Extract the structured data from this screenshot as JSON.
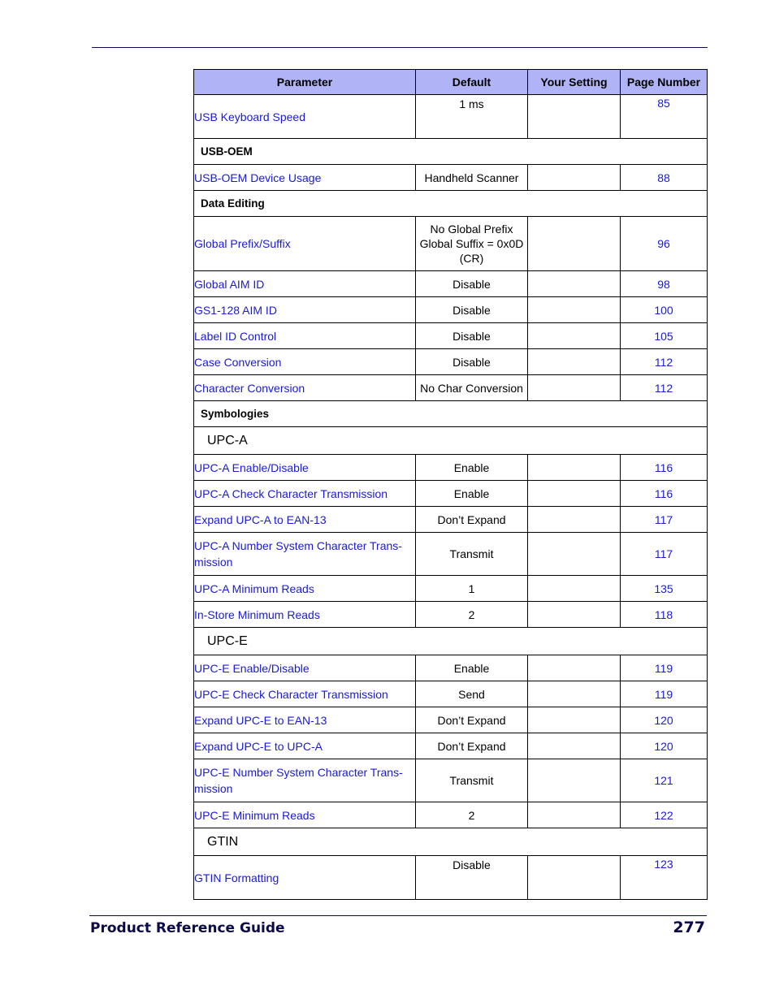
{
  "columns": [
    "Parameter",
    "Default",
    "Your Setting",
    "Page Number"
  ],
  "rows": [
    {
      "type": "row",
      "kind": "tall",
      "param": "USB Keyboard Speed",
      "default": "1 ms",
      "setting": "",
      "page": "85"
    },
    {
      "type": "group",
      "label": "USB-OEM"
    },
    {
      "type": "row",
      "param": "USB-OEM Device Usage",
      "default": "Handheld Scanner",
      "setting": "",
      "page": "88"
    },
    {
      "type": "group",
      "label": "Data Editing"
    },
    {
      "type": "row",
      "kind": "three",
      "param": "Global Prefix/Suffix",
      "default": "No Global Prefix\nGlobal Suffix = 0x0D\n(CR)",
      "setting": "",
      "page": "96"
    },
    {
      "type": "row",
      "param": "Global AIM ID",
      "default": "Disable",
      "setting": "",
      "page": "98"
    },
    {
      "type": "row",
      "param": "GS1-128 AIM ID",
      "default": "Disable",
      "setting": "",
      "page": "100"
    },
    {
      "type": "row",
      "param": "Label ID Control",
      "default": "Disable",
      "setting": "",
      "page": "105"
    },
    {
      "type": "row",
      "param": "Case Conversion",
      "default": "Disable",
      "setting": "",
      "page": "112"
    },
    {
      "type": "row",
      "param": "Character Conversion",
      "default": "No Char Conversion",
      "setting": "",
      "page": "112"
    },
    {
      "type": "group",
      "label": "Symbologies"
    },
    {
      "type": "sub",
      "label": "UPC-A"
    },
    {
      "type": "row",
      "param": "UPC-A Enable/Disable",
      "default": "Enable",
      "setting": "",
      "page": "116"
    },
    {
      "type": "row",
      "param": "UPC-A Check Character Transmission",
      "default": "Enable",
      "setting": "",
      "page": "116"
    },
    {
      "type": "row",
      "param": "Expand UPC-A to EAN-13",
      "default": "Don’t Expand",
      "setting": "",
      "page": "117"
    },
    {
      "type": "row",
      "kind": "two",
      "param": "UPC-A Number System Character Trans-\nmission",
      "default": "Transmit",
      "setting": "",
      "page": "117"
    },
    {
      "type": "row",
      "param": "UPC-A Minimum Reads",
      "default": "1",
      "setting": "",
      "page": "135"
    },
    {
      "type": "row",
      "param": "In-Store Minimum Reads",
      "default": "2",
      "setting": "",
      "page": "118"
    },
    {
      "type": "sub",
      "label": "UPC-E"
    },
    {
      "type": "row",
      "param": "UPC-E Enable/Disable",
      "default": "Enable",
      "setting": "",
      "page": "119"
    },
    {
      "type": "row",
      "param": "UPC-E Check Character Transmission",
      "default": "Send",
      "setting": "",
      "page": "119"
    },
    {
      "type": "row",
      "param": "Expand UPC-E to EAN-13",
      "default": "Don’t Expand",
      "setting": "",
      "page": "120"
    },
    {
      "type": "row",
      "param": "Expand UPC-E to UPC-A",
      "default": "Don’t Expand",
      "setting": "",
      "page": "120"
    },
    {
      "type": "row",
      "kind": "two",
      "param": "UPC-E Number System Character Trans-\nmission",
      "default": "Transmit",
      "setting": "",
      "page": "121"
    },
    {
      "type": "row",
      "param": "UPC-E Minimum Reads",
      "default": "2",
      "setting": "",
      "page": "122"
    },
    {
      "type": "sub",
      "label": "GTIN"
    },
    {
      "type": "row",
      "kind": "tall",
      "param": "GTIN Formatting",
      "default": "Disable",
      "setting": "",
      "page": "123"
    }
  ],
  "footer": {
    "title": "Product Reference Guide",
    "page": "277"
  },
  "colors": {
    "header_bg": "#b0b3f5",
    "link": "#1a1ad6",
    "footer": "#0a0a4a"
  }
}
